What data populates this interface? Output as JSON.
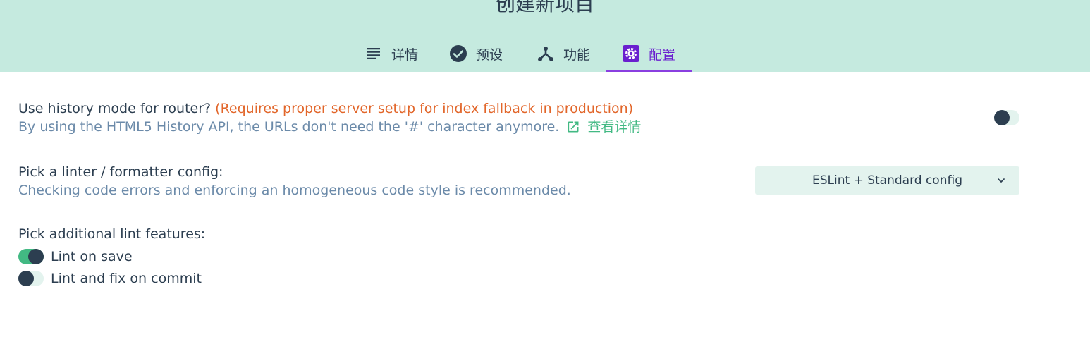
{
  "header": {
    "title": "创建新项目",
    "tabs": [
      {
        "label": "详情",
        "icon": "list-icon"
      },
      {
        "label": "预设",
        "icon": "check-circle-icon"
      },
      {
        "label": "功能",
        "icon": "fork-icon"
      },
      {
        "label": "配置",
        "icon": "gear-icon",
        "active": true
      }
    ]
  },
  "colors": {
    "header_bg": "#c5eadf",
    "accent": "#8a3fe0",
    "warning": "#e2662a",
    "link": "#42b983",
    "description": "#6b8aa9"
  },
  "history_mode": {
    "label": "Use history mode for router?",
    "warning": "(Requires proper server setup for index fallback in production)",
    "description": "By using the HTML5 History API, the URLs don't need the '#' character anymore.",
    "link_label": "查看详情",
    "enabled": false
  },
  "linter": {
    "label": "Pick a linter / formatter config:",
    "description": "Checking code errors and enforcing an homogeneous code style is recommended.",
    "selected": "ESLint + Standard config"
  },
  "lint_features": {
    "label": "Pick additional lint features:",
    "options": [
      {
        "label": "Lint on save",
        "checked": true
      },
      {
        "label": "Lint and fix on commit",
        "checked": false
      }
    ]
  }
}
